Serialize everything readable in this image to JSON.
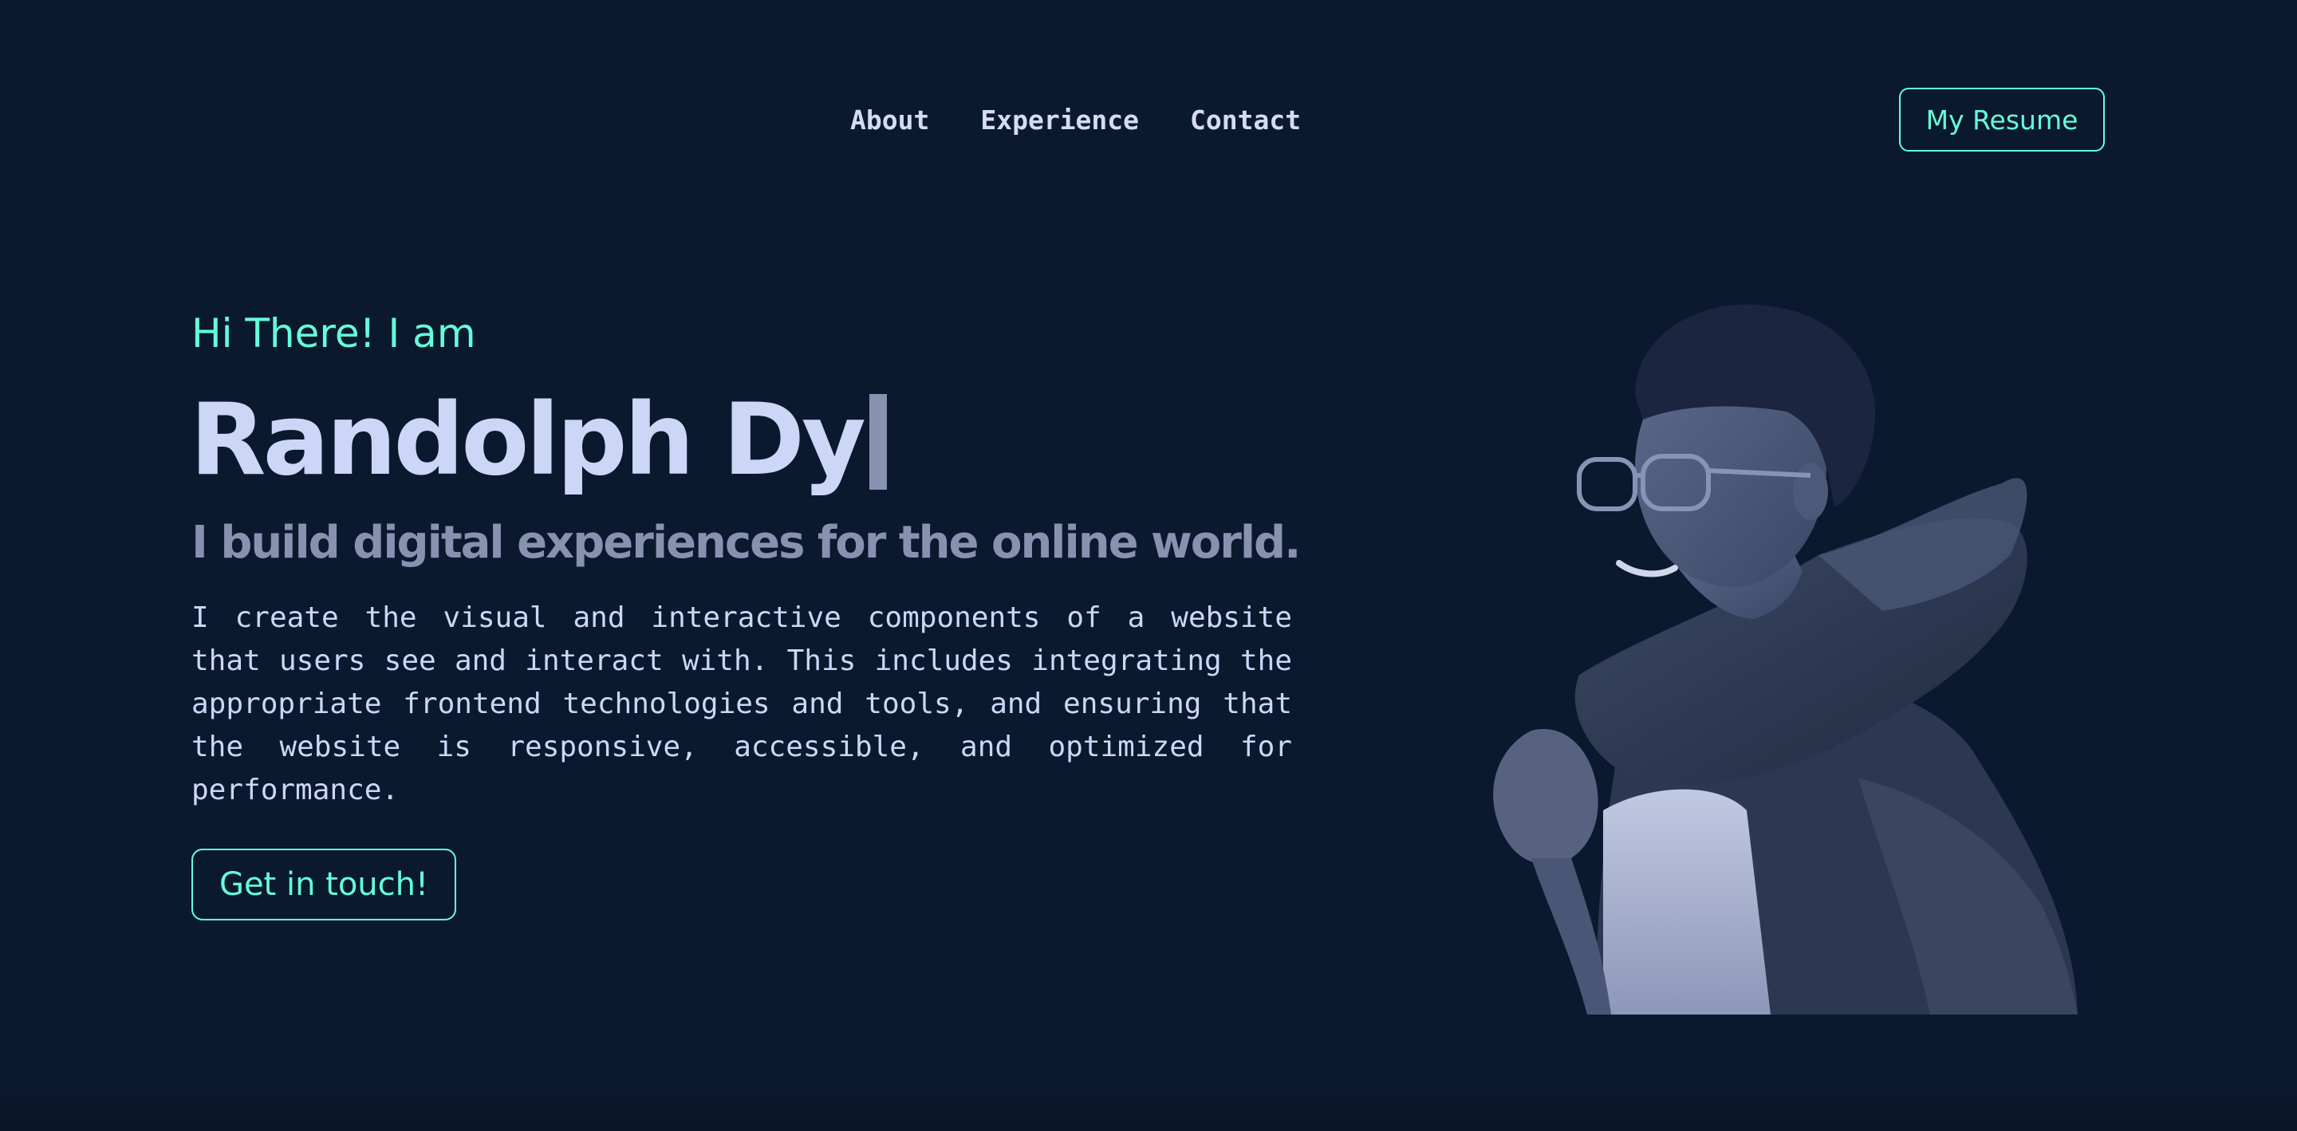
{
  "nav": {
    "items": [
      {
        "label": "About"
      },
      {
        "label": "Experience"
      },
      {
        "label": "Contact"
      }
    ],
    "resume_label": "My Resume"
  },
  "hero": {
    "greeting": "Hi There! I am",
    "name": "Randolph Dy",
    "tagline": "I build digital experiences for the online world.",
    "description": "I create the visual and interactive components of a website that users see and interact with. This includes integrating the appropriate frontend technologies and tools, and ensuring that the website is responsive, accessible, and optimized for performance.",
    "cta_label": "Get in touch!"
  },
  "colors": {
    "background": "#0b192f",
    "accent": "#64ffda",
    "heading": "#ccd6f6",
    "muted": "#8892b0"
  },
  "portrait": {
    "icon": "person-portrait-illustration"
  }
}
